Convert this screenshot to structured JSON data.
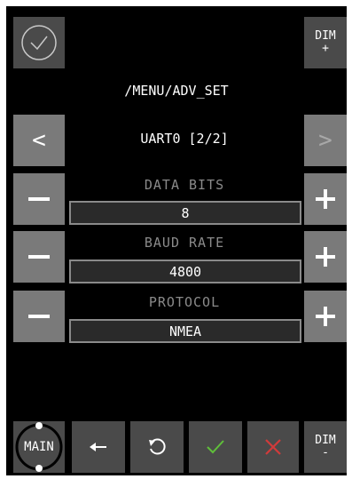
{
  "header": {
    "path": "/MENU/ADV_SET"
  },
  "nav": {
    "title": "UART0 [2/2]",
    "prev_glyph": "<",
    "next_glyph": ">"
  },
  "fields": [
    {
      "label": "DATA BITS",
      "value": "8"
    },
    {
      "label": "BAUD RATE",
      "value": "4800"
    },
    {
      "label": "PROTOCOL",
      "value": "NMEA"
    }
  ],
  "dim_top": {
    "line1": "DIM",
    "line2": "+"
  },
  "dim_bottom": {
    "line1": "DIM",
    "line2": "-"
  },
  "footer": {
    "main_label": "MAIN"
  },
  "colors": {
    "accept": "#5fbf3a",
    "cancel": "#d03a3a"
  },
  "icons": {
    "top_left": "check-circle-icon",
    "back": "arrow-left-icon",
    "reset": "refresh-icon",
    "accept": "check-icon",
    "cancel": "x-icon"
  }
}
